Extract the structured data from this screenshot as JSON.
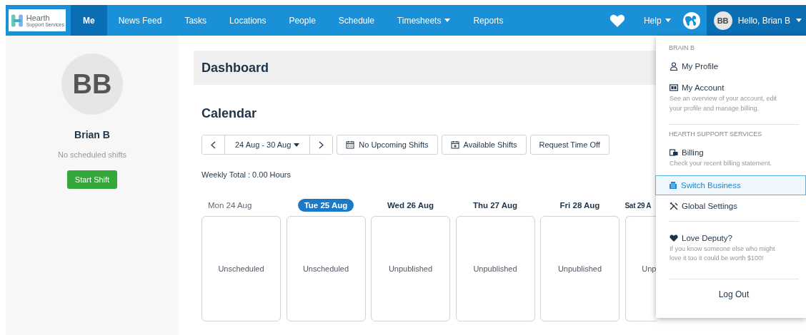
{
  "logo": {
    "name": "Hearth",
    "tagline": "Support Services"
  },
  "nav": [
    {
      "label": "Me",
      "selected": true,
      "caret": false
    },
    {
      "label": "News Feed",
      "selected": false,
      "caret": false
    },
    {
      "label": "Tasks",
      "selected": false,
      "caret": false
    },
    {
      "label": "Locations",
      "selected": false,
      "caret": false
    },
    {
      "label": "People",
      "selected": false,
      "caret": false
    },
    {
      "label": "Schedule",
      "selected": false,
      "caret": false
    },
    {
      "label": "Timesheets",
      "selected": false,
      "caret": true
    },
    {
      "label": "Reports",
      "selected": false,
      "caret": false
    }
  ],
  "help": {
    "label": "Help"
  },
  "user": {
    "initials": "BB",
    "greeting": "Hello, Brian B"
  },
  "profile": {
    "initials": "BB",
    "name": "Brian B",
    "status": "No scheduled shifts",
    "button": "Start Shift"
  },
  "dashboard": {
    "title": "Dashboard"
  },
  "calendar": {
    "title": "Calendar",
    "range": "24 Aug - 30 Aug",
    "actions": [
      {
        "kind": "calendar",
        "label": "No Upcoming Shifts"
      },
      {
        "kind": "calendar-plus",
        "label": "Available Shifts"
      },
      {
        "kind": "plain",
        "label": "Request Time Off"
      }
    ],
    "weekly_total": "Weekly Total : 0.00 Hours",
    "days": [
      {
        "label": "Mon 24 Aug",
        "selected": false,
        "past": true,
        "status": "Unscheduled"
      },
      {
        "label": "Tue 25 Aug",
        "selected": true,
        "past": false,
        "status": "Unscheduled"
      },
      {
        "label": "Wed 26 Aug",
        "selected": false,
        "past": false,
        "status": "Unpublished"
      },
      {
        "label": "Thu 27 Aug",
        "selected": false,
        "past": false,
        "status": "Unpublished"
      },
      {
        "label": "Fri 28 Aug",
        "selected": false,
        "past": false,
        "status": "Unpublished"
      },
      {
        "label": "Sat 29 A",
        "selected": false,
        "past": false,
        "status": "Unp"
      }
    ]
  },
  "menu": {
    "sections": [
      {
        "heading": "BRAIN B",
        "items": [
          {
            "kind": "person",
            "label": "My Profile",
            "selected": false
          },
          {
            "kind": "id-card",
            "label": "My Account",
            "description": "See an overview of your account, edit your profile and manage billing.",
            "selected": false
          }
        ]
      },
      {
        "heading": "HEARTH SUPPORT SERVICES",
        "items": [
          {
            "kind": "bills",
            "label": "Billing",
            "description": "Check your recent billing statement.",
            "selected": false
          },
          {
            "kind": "building",
            "label": "Switch Business",
            "selected": true
          },
          {
            "kind": "tools",
            "label": "Global Settings",
            "selected": false
          }
        ]
      },
      {
        "items": [
          {
            "kind": "heart",
            "label": "Love Deputy?",
            "description": "If you know someone else who might love it too it could be worth $100!",
            "selected": false
          }
        ]
      }
    ],
    "logout": "Log Out"
  }
}
